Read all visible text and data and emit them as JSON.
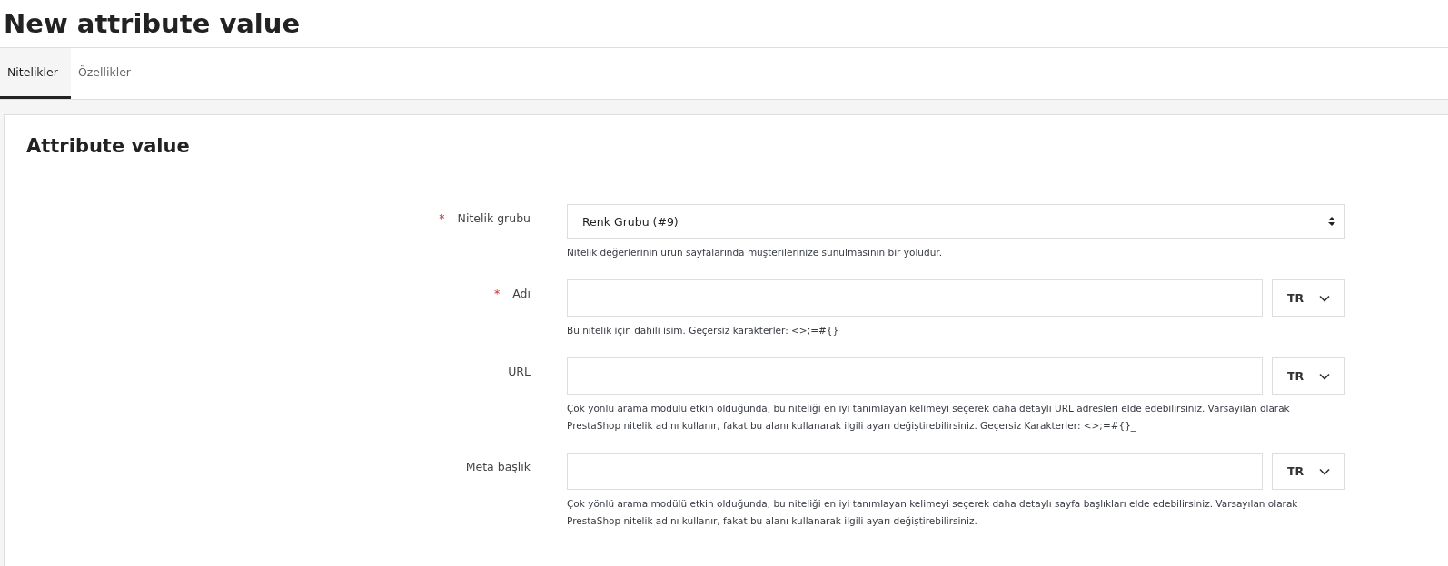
{
  "page_title": "New attribute value",
  "tabs": [
    {
      "label": "Nitelikler",
      "selected": true
    },
    {
      "label": "Özellikler",
      "selected": false
    }
  ],
  "card": {
    "title": "Attribute value",
    "fields": [
      {
        "kind": "select",
        "label": "Nitelik grubu",
        "required_mark": "*",
        "value": "Renk Grubu (#9)",
        "help": "Nitelik değerlerinin ürün sayfalarında müşterilerinize sunulmasının bir yoludur."
      },
      {
        "kind": "text",
        "label": "Adı",
        "required_mark": "*",
        "language": "TR",
        "help": "Bu nitelik için dahili isim. Geçersiz karakterler: <>;=#{}"
      },
      {
        "kind": "text",
        "label": "URL",
        "language": "TR",
        "help": "Çok yönlü arama modülü etkin olduğunda, bu niteliği en iyi tanımlayan kelimeyi seçerek daha detaylı URL adresleri elde edebilirsiniz. Varsayılan olarak PrestaShop nitelik adını kullanır, fakat bu alanı kullanarak ilgili ayarı değiştirebilirsiniz. Geçersiz Karakterler: <>;=#{}_"
      },
      {
        "kind": "text",
        "label": "Meta başlık",
        "language": "TR",
        "help": "Çok yönlü arama modülü etkin olduğunda, bu niteliği en iyi tanımlayan kelimeyi seçerek daha detaylı sayfa başlıkları elde edebilirsiniz. Varsayılan olarak PrestaShop nitelik adını kullanır, fakat bu alanı kullanarak ilgili ayarı değiştirebilirsiniz."
      }
    ]
  }
}
